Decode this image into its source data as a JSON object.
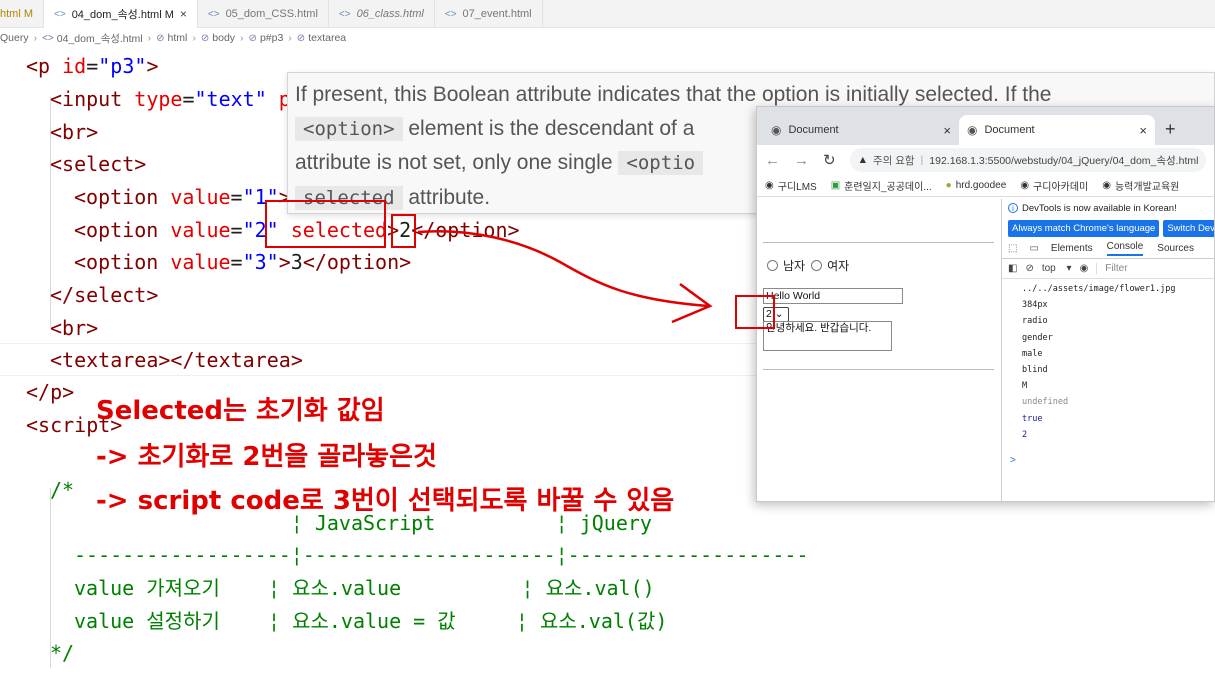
{
  "editor": {
    "tabs": [
      {
        "label": "html M"
      },
      {
        "label": "04_dom_속성.html M",
        "close": "×"
      },
      {
        "label": "05_dom_CSS.html"
      },
      {
        "label": "06_class.html"
      },
      {
        "label": "07_event.html"
      }
    ],
    "breadcrumb": [
      "Query",
      "04_dom_속성.html",
      "html",
      "body",
      "p#p3",
      "textarea"
    ],
    "code": {
      "l1": [
        "<p ",
        "id",
        "=",
        "\"p3\"",
        ">"
      ],
      "l2": [
        "<input ",
        "type",
        "=",
        "\"text\"",
        " p"
      ],
      "l3": [
        "<br>"
      ],
      "l4": [
        "<select>"
      ],
      "l5": [
        "<option ",
        "value",
        "=",
        "\"1\"",
        ">"
      ],
      "l6": [
        "<option ",
        "value",
        "=",
        "\"2\"",
        " selected",
        ">",
        "2",
        "</option>"
      ],
      "l7": [
        "<option ",
        "value",
        "=",
        "\"3\"",
        ">",
        "3",
        "</option>"
      ],
      "l8": [
        "</select>"
      ],
      "l9": [
        "<br>"
      ],
      "l10": [
        "<textarea></textarea>"
      ],
      "l11": [
        "</p>"
      ],
      "l12": [
        "<script>"
      ],
      "l13": "/*",
      "l14": "                  ¦ JavaScript          ¦ jQuery",
      "l15": "------------------¦---------------------¦--------------------",
      "l16": "value 가져오기    ¦ 요소.value          ¦ 요소.val()",
      "l17": "value 설정하기    ¦ 요소.value = 값     ¦ 요소.val(값)",
      "l18": "*/"
    }
  },
  "hover_doc": {
    "line1": "If present, this Boolean attribute indicates that the option is initially selected. If the",
    "code1": "<option>",
    "line2": "element is the descendant of a",
    "line3": "attribute is not set, only one single",
    "code2": "<optio",
    "code3": "selected",
    "line4": "attribute."
  },
  "browser": {
    "tabs": [
      {
        "label": "Document",
        "close": "×"
      },
      {
        "label": "Document",
        "close": "×"
      }
    ],
    "new_tab": "+",
    "security": "주의 요함",
    "url": "192.168.1.3:5500/webstudy/04_jQuery/04_dom_속성.html",
    "bookmarks": [
      "구디LMS",
      "훈련일지_공공데이...",
      "hrd.goodee",
      "구디아카데미",
      "능력개발교육원"
    ],
    "page": {
      "radio1": "남자",
      "radio2": "여자",
      "text_value": "Hello World",
      "select_value": "2",
      "textarea_value": "안녕하세요. 반갑습니다."
    },
    "devtools": {
      "notice": "DevTools is now available in Korean!",
      "btn1": "Always match Chrome's language",
      "btn2": "Switch DevT",
      "tabs": [
        "Elements",
        "Console",
        "Sources"
      ],
      "context": "top",
      "filter": "Filter",
      "console": [
        "../../assets/image/flower1.jpg",
        "384px",
        "radio",
        "gender",
        "male",
        "blind",
        "M",
        "undefined",
        "true",
        "2"
      ],
      "prompt": ">"
    }
  },
  "annotations": {
    "note1": "Selected는 초기화 값임",
    "note2": "-> 초기화로 2번을 골라놓은것",
    "note3": "-> script code로 3번이 선택되도록 바꿀 수 있음",
    "color": "#e00000"
  }
}
